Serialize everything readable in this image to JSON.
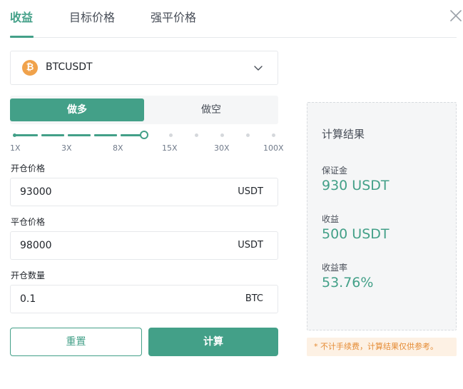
{
  "tabs": [
    {
      "label": "收益"
    },
    {
      "label": "目标价格"
    },
    {
      "label": "强平价格"
    }
  ],
  "symbol": {
    "coin_glyph": "₿",
    "name": "BTCUSDT",
    "coin_color": "#f0a24b"
  },
  "direction": {
    "long_label": "做多",
    "short_label": "做空",
    "selected": "long"
  },
  "leverage": {
    "ticks": [
      "1X",
      "3X",
      "8X",
      "15X",
      "30X",
      "100X"
    ],
    "selected_step_fraction": 0.5
  },
  "fields": {
    "open_price": {
      "label": "开仓价格",
      "value": "93000",
      "unit": "USDT"
    },
    "close_price": {
      "label": "平仓价格",
      "value": "98000",
      "unit": "USDT"
    },
    "quantity": {
      "label": "开仓数量",
      "value": "0.1",
      "unit": "BTC"
    }
  },
  "buttons": {
    "reset_label": "重置",
    "calc_label": "计算"
  },
  "result": {
    "title": "计算结果",
    "margin_label": "保证金",
    "margin_value": "930 USDT",
    "pnl_label": "收益",
    "pnl_value": "500 USDT",
    "roe_label": "收益率",
    "roe_value": "53.76%"
  },
  "notice": "* 不计手续费，计算结果仅供参考。",
  "colors": {
    "accent": "#43a088",
    "warning": "#e58c35"
  }
}
